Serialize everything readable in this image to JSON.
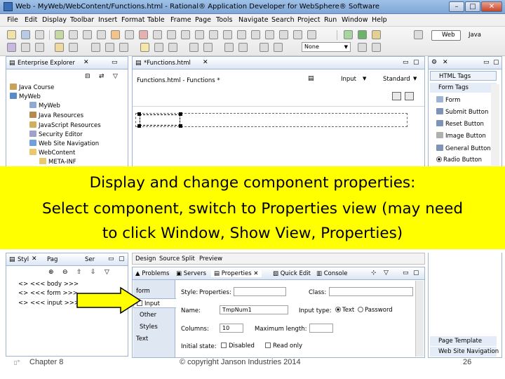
{
  "window": {
    "title": "Web - MyWeb/WebContent/Functions.html - Rational® Application Developer for WebSphere® Software"
  },
  "menu": [
    "File",
    "Edit",
    "Display",
    "Toolbar",
    "Insert",
    "Format",
    "Table",
    "Frame",
    "Page",
    "Tools",
    "Navigate",
    "Search",
    "Project",
    "Run",
    "Window",
    "Help"
  ],
  "toolbar": {
    "font_select": "None",
    "perspective_web": "Web",
    "perspective_java": "Java"
  },
  "enterprise_explorer": {
    "title": "Enterprise Explorer",
    "items": [
      {
        "label": "Java Course",
        "indent": 1
      },
      {
        "label": "MyWeb",
        "indent": 1
      },
      {
        "label": "MyWeb",
        "indent": 2
      },
      {
        "label": "Java Resources",
        "indent": 2
      },
      {
        "label": "JavaScript Resources",
        "indent": 2
      },
      {
        "label": "Security Editor",
        "indent": 2
      },
      {
        "label": "Web Site Navigation",
        "indent": 2
      },
      {
        "label": "WebContent",
        "indent": 2
      },
      {
        "label": "META-INF",
        "indent": 3
      }
    ]
  },
  "editor": {
    "tab": "*Functions.html",
    "header": "Functions.html - Functions *",
    "input_dropdown": "Input",
    "standard_dropdown": "Standard",
    "bottom_tabs": [
      "Design",
      "Source",
      "Split",
      "Preview"
    ]
  },
  "palette": {
    "title_tab": "HTML Tags",
    "drawer": "Form Tags",
    "items": [
      "Form",
      "Submit Button",
      "Reset Button",
      "Image Button",
      "General Button",
      "Radio Button"
    ],
    "bottom_items": [
      "Page Template",
      "Web Site Navigation"
    ]
  },
  "styles_panel": {
    "tabs": [
      "Styl",
      "Pag",
      "Ser"
    ],
    "items": [
      "<> <<< body >>>",
      "<> <<< form >>>",
      "<> <<< input >>>"
    ]
  },
  "bottom_tabs": [
    "Problems",
    "Servers",
    "Properties",
    "Quick Edit",
    "Console"
  ],
  "properties": {
    "side_tabs": [
      "form",
      "Input",
      "Other",
      "Styles",
      "Text"
    ],
    "style_label": "Style:",
    "properties_label": "Properties:",
    "class_label": "Class:",
    "name_label": "Name:",
    "name_value": "TmpNum1",
    "input_type_label": "Input type:",
    "radio_text": "Text",
    "radio_password": "Password",
    "columns_label": "Columns:",
    "columns_value": "10",
    "max_length_label": "Maximum length:",
    "initial_state_label": "Initial state:",
    "disabled_label": "Disabled",
    "read_only_label": "Read only"
  },
  "overlay": {
    "line1": "Display and change component properties:",
    "line2": "Select component, switch to Properties view (may need",
    "line3": "to click Window, Show View, Properties)"
  },
  "footer": {
    "chapter": "Chapter 8",
    "copyright": "© copyright Janson Industries 2014",
    "page": "26"
  },
  "colors": {
    "overlay": "#ffff00",
    "arrow": "#ffff00",
    "panel_border": "#9db4d2"
  }
}
